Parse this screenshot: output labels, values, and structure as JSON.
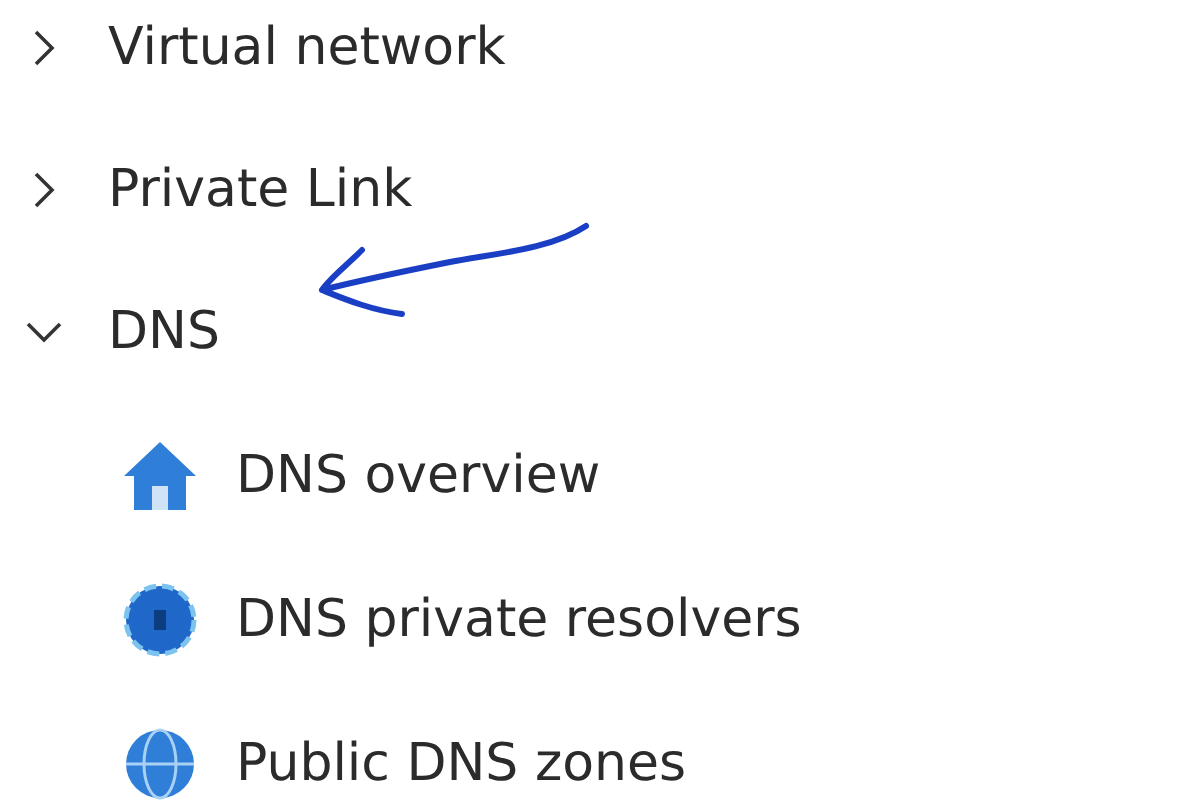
{
  "nav_tree": [
    {
      "label": "Virtual network",
      "expanded": false
    },
    {
      "label": "Private Link",
      "expanded": false
    },
    {
      "label": "DNS",
      "expanded": true,
      "annotated": true,
      "children": [
        {
          "label": "DNS overview",
          "kind": "home"
        },
        {
          "label": "DNS private resolvers",
          "kind": "resolver"
        },
        {
          "label": "Public DNS zones",
          "kind": "zone"
        }
      ]
    }
  ]
}
